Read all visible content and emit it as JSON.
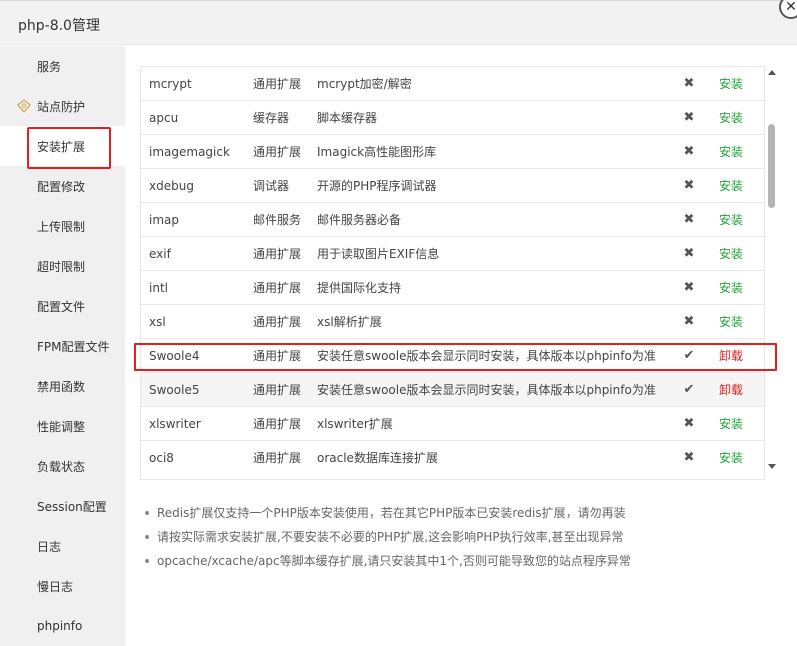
{
  "window": {
    "title": "php-8.0管理",
    "close_icon": "close-icon"
  },
  "sidebar": {
    "items": [
      {
        "label": "服务"
      },
      {
        "label": "站点防护",
        "icon": "diamond-icon",
        "icon_color": "#c9a45c"
      },
      {
        "label": "安装扩展",
        "active": true
      },
      {
        "label": "配置修改"
      },
      {
        "label": "上传限制"
      },
      {
        "label": "超时限制"
      },
      {
        "label": "配置文件"
      },
      {
        "label": "FPM配置文件"
      },
      {
        "label": "禁用函数"
      },
      {
        "label": "性能调整"
      },
      {
        "label": "负载状态"
      },
      {
        "label": "Session配置"
      },
      {
        "label": "日志"
      },
      {
        "label": "慢日志"
      },
      {
        "label": "phpinfo"
      }
    ]
  },
  "extensions": {
    "rows": [
      {
        "name": "mcrypt",
        "type": "通用扩展",
        "desc": "mcrypt加密/解密",
        "status_icon": "x-icon",
        "action": "安装"
      },
      {
        "name": "apcu",
        "type": "缓存器",
        "desc": "脚本缓存器",
        "status_icon": "x-icon",
        "action": "安装"
      },
      {
        "name": "imagemagick",
        "type": "通用扩展",
        "desc": "Imagick高性能图形库",
        "status_icon": "x-icon",
        "action": "安装"
      },
      {
        "name": "xdebug",
        "type": "调试器",
        "desc": "开源的PHP程序调试器",
        "status_icon": "x-icon",
        "action": "安装"
      },
      {
        "name": "imap",
        "type": "邮件服务",
        "desc": "邮件服务器必备",
        "status_icon": "x-icon",
        "action": "安装"
      },
      {
        "name": "exif",
        "type": "通用扩展",
        "desc": "用于读取图片EXIF信息",
        "status_icon": "x-icon",
        "action": "安装"
      },
      {
        "name": "intl",
        "type": "通用扩展",
        "desc": "提供国际化支持",
        "status_icon": "x-icon",
        "action": "安装"
      },
      {
        "name": "xsl",
        "type": "通用扩展",
        "desc": "xsl解析扩展",
        "status_icon": "x-icon",
        "action": "安装"
      },
      {
        "name": "Swoole4",
        "type": "通用扩展",
        "desc": "安装任意swoole版本会显示同时安装，具体版本以phpinfo为准",
        "status_icon": "check-icon",
        "action": "卸载"
      },
      {
        "name": "Swoole5",
        "type": "通用扩展",
        "desc": "安装任意swoole版本会显示同时安装，具体版本以phpinfo为准",
        "status_icon": "check-icon",
        "action": "卸载"
      },
      {
        "name": "xlswriter",
        "type": "通用扩展",
        "desc": "xlswriter扩展",
        "status_icon": "x-icon",
        "action": "安装"
      },
      {
        "name": "oci8",
        "type": "通用扩展",
        "desc": "oracle数据库连接扩展",
        "status_icon": "x-icon",
        "action": "安装"
      }
    ],
    "install_color": "#20a53a",
    "uninstall_color": "#e02020"
  },
  "notes": [
    "Redis扩展仅支持一个PHP版本安装使用，若在其它PHP版本已安装redis扩展，请勿再装",
    "请按实际需求安装扩展,不要安装不必要的PHP扩展,这会影响PHP执行效率,甚至出现异常",
    "opcache/xcache/apc等脚本缓存扩展,请只安装其中1个,否则可能导致您的站点程序异常"
  ]
}
